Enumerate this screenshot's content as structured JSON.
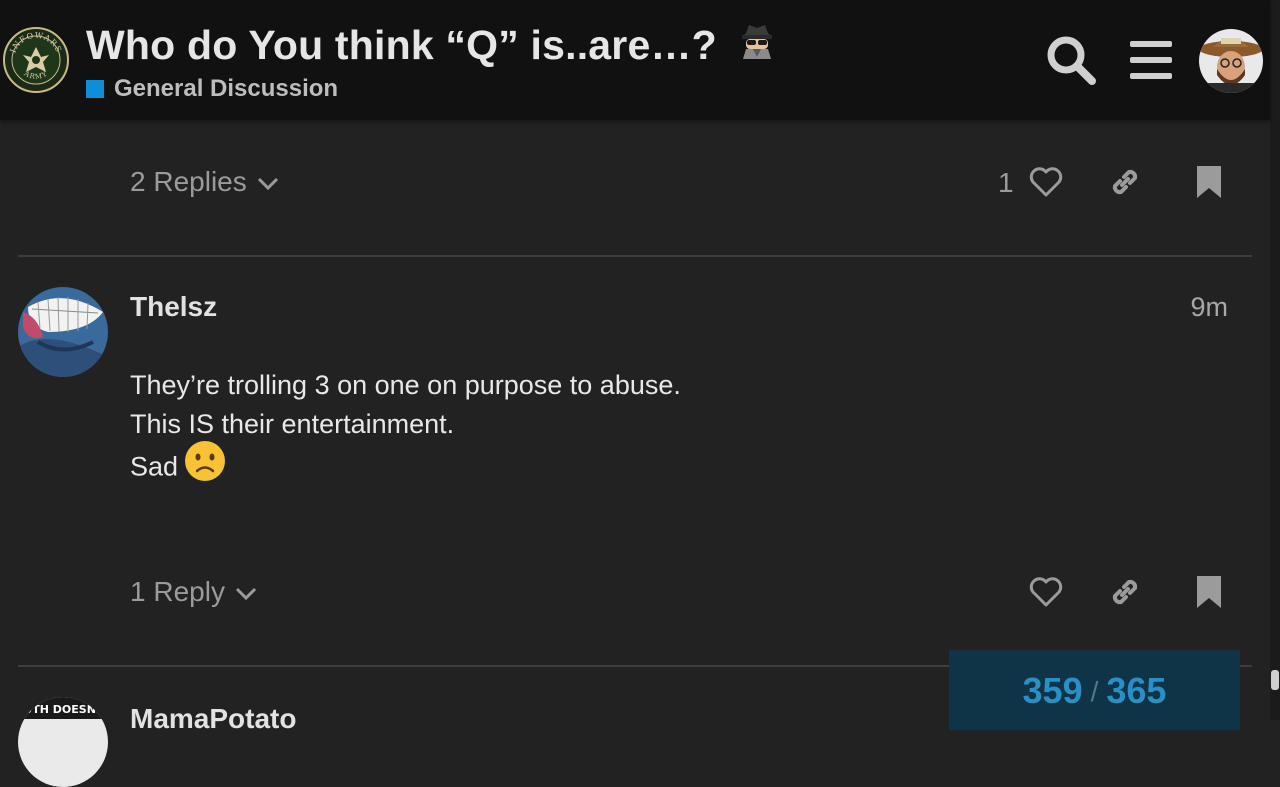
{
  "header": {
    "title": "Who do You think “Q” is..are…?",
    "title_emoji": "detective-icon",
    "category": "General Discussion",
    "category_color": "#0e8ed8",
    "logo_text_top": "INFOWARS",
    "logo_text_bottom": "ARMY"
  },
  "posts": [
    {
      "replies_label": "2 Replies",
      "like_count": "1"
    },
    {
      "username": "Thelsz",
      "time": "9m",
      "body": [
        "They’re trolling 3 on one on purpose to abuse.",
        "This IS their entertainment.",
        "Sad"
      ],
      "body_emoji": "frowning-face-icon",
      "replies_label": "1 Reply"
    },
    {
      "username": "MamaPotato",
      "avatar_text": "TRUTH DOESN'T C"
    }
  ],
  "progress": {
    "current": "359",
    "separator": "/",
    "total": "365"
  },
  "colors": {
    "background": "#222222",
    "header": "#111111",
    "accent": "#0e8ed8",
    "progress_bg": "#0f3447",
    "progress_text": "#2a8fc6"
  }
}
